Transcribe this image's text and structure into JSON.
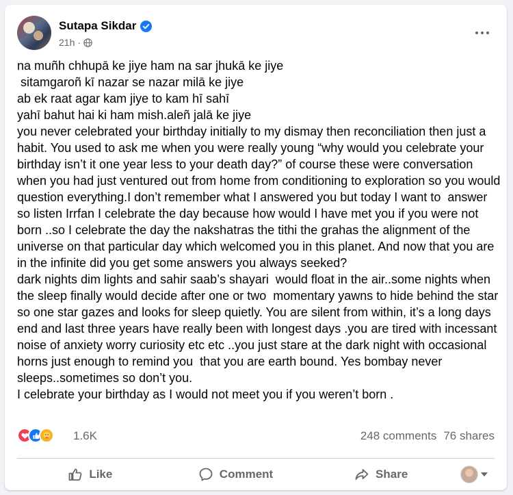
{
  "post": {
    "author": "Sutapa Sikdar",
    "time": "21h",
    "dot": "·",
    "text": "na muñh chhupā ke jiye ham na sar jhukā ke jiye\n sitamgaroñ kī nazar se nazar milā ke jiye\nab ek raat agar kam jiye to kam hī sahī\nyahī bahut hai ki ham mish.aleñ jalā ke jiye\nyou never celebrated your birthday initially to my dismay then reconciliation then just a habit. You used to ask me when you were really young “why would you celebrate your birthday isn’t it one year less to your death day?” of course these were conversation when you had just ventured out from home from conditioning to exploration so you would question everything.I don’t remember what I answered you but today I want to  answer so listen Irrfan I celebrate the day because how would I have met you if you were not  born ..so I celebrate the day the nakshatras the tithi the grahas the alignment of the universe on that particular day which welcomed you in this planet. And now that you are in the infinite did you get some answers you always seeked?\ndark nights dim lights and sahir saab’s shayari  would float in the air..some nights when the sleep finally would decide after one or two  momentary yawns to hide behind the star so one star gazes and looks for sleep quietly. You are silent from within, it’s a long days end and last three years have really been with longest days .you are tired with incessant noise of anxiety worry curiosity etc etc ..you just stare at the dark night with occasional horns just enough to remind you  that you are earth bound. Yes bombay never sleeps..sometimes so don’t you.\nI celebrate your birthday as I would not meet you if you weren’t born ."
  },
  "stats": {
    "reaction_count": "1.6K",
    "comments": "248 comments",
    "shares": "76 shares",
    "reactions": [
      "love-icon",
      "like-icon",
      "care-icon"
    ]
  },
  "actions": {
    "like": "Like",
    "comment": "Comment",
    "share": "Share"
  },
  "colors": {
    "brand_blue": "#1877f2",
    "secondary_text": "#65676b",
    "love": "#f33e58",
    "care": "#f7b125"
  }
}
